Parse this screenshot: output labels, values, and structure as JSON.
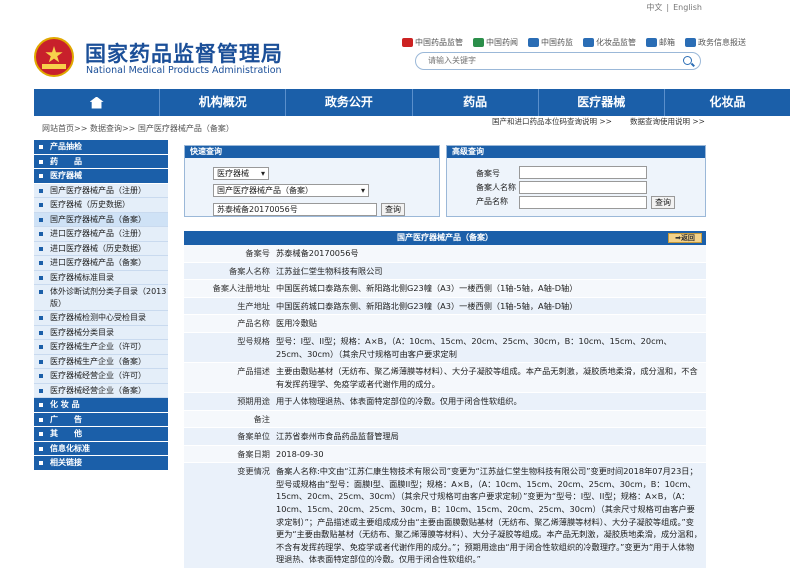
{
  "lang": {
    "cn": "中文",
    "sep": "|",
    "en": "English"
  },
  "header": {
    "title_cn": "国家药品监督管理局",
    "title_en": "National Medical Products Administration"
  },
  "toplinks": [
    "中国药品监管",
    "中国药闻",
    "中国药监",
    "化妆品监管",
    "邮箱",
    "政务信息报送"
  ],
  "search": {
    "placeholder": "请输入关键字"
  },
  "nav": [
    "机构概况",
    "政务公开",
    "药品",
    "医疗器械",
    "化妆品"
  ],
  "breadcrumb": "网站首页>> 数据查询>> 国产医疗器械产品（备案）",
  "right_links": [
    "国产和进口药品本位码查询说明 >>",
    "数据查询使用说明 >>"
  ],
  "sidebar": [
    {
      "label": "产品抽检",
      "type": "h"
    },
    {
      "label": "药　　品",
      "type": "h"
    },
    {
      "label": "医疗器械",
      "type": "h"
    },
    {
      "label": "国产医疗器械产品（注册）",
      "type": "s"
    },
    {
      "label": "医疗器械（历史数据）",
      "type": "s"
    },
    {
      "label": "国产医疗器械产品（备案）",
      "type": "s",
      "active": true
    },
    {
      "label": "进口医疗器械产品（注册）",
      "type": "s"
    },
    {
      "label": "进口医疗器械（历史数据）",
      "type": "s"
    },
    {
      "label": "进口医疗器械产品（备案）",
      "type": "s"
    },
    {
      "label": "医疗器械标准目录",
      "type": "s"
    },
    {
      "label": "体外诊断试剂分类子目录（2013版）",
      "type": "s",
      "tall": true
    },
    {
      "label": "医疗器械检测中心受检目录",
      "type": "s"
    },
    {
      "label": "医疗器械分类目录",
      "type": "s"
    },
    {
      "label": "医疗器械生产企业（许可）",
      "type": "s"
    },
    {
      "label": "医疗器械生产企业（备案）",
      "type": "s"
    },
    {
      "label": "医疗器械经营企业（许可）",
      "type": "s"
    },
    {
      "label": "医疗器械经营企业（备案）",
      "type": "s"
    },
    {
      "label": "化 妆 品",
      "type": "h"
    },
    {
      "label": "广　　告",
      "type": "h"
    },
    {
      "label": "其　　他",
      "type": "h"
    },
    {
      "label": "信息化标准",
      "type": "h"
    },
    {
      "label": "相关链接",
      "type": "h"
    }
  ],
  "quick": {
    "title": "快速查询",
    "sel1": "医疗器械",
    "sel2": "国产医疗器械产品（备案）",
    "input": "苏泰械备20170056号",
    "btn": "查询"
  },
  "adv": {
    "title": "高级查询",
    "f1": "备案号",
    "f2": "备案人名称",
    "f3": "产品名称",
    "btn": "查询"
  },
  "detail": {
    "title": "国产医疗器械产品（备案）",
    "back": "返回",
    "rows": [
      {
        "k": "备案号",
        "v": "苏泰械备20170056号"
      },
      {
        "k": "备案人名称",
        "v": "江苏益仁堂生物科技有限公司"
      },
      {
        "k": "备案人注册地址",
        "v": "中国医药城口泰路东侧、新阳路北侧G23幢（A3）一楼西侧（1轴-5轴，A轴-D轴）"
      },
      {
        "k": "生产地址",
        "v": "中国医药城口泰路东侧、新阳路北侧G23幢（A3）一楼西侧（1轴-5轴，A轴-D轴）"
      },
      {
        "k": "产品名称",
        "v": "医用冷敷贴"
      },
      {
        "k": "型号规格",
        "v": "型号：I型、II型；规格：A×B，（A：10cm、15cm、20cm、25cm、30cm，B：10cm、15cm、20cm、25cm、30cm）（其余尺寸规格可由客户要求定制"
      },
      {
        "k": "产品描述",
        "v": "主要由敷贴基材（无纺布、聚乙烯薄膜等材料）、大分子凝胶等组成。本产品无刺激，凝胶质地柔滑，成分温和，不含有发挥药理学、免疫学或者代谢作用的成分。"
      },
      {
        "k": "预期用途",
        "v": "用于人体物理退热、体表面特定部位的冷敷。仅用于闭合性软组织。"
      },
      {
        "k": "备注",
        "v": ""
      },
      {
        "k": "备案单位",
        "v": "江苏省泰州市食品药品监督管理局"
      },
      {
        "k": "备案日期",
        "v": "2018-09-30"
      },
      {
        "k": "变更情况",
        "v": "备案人名称:中文由“江苏仁康生物技术有限公司”变更为“江苏益仁堂生物科技有限公司”变更时间2018年07月23日；型号或规格由“型号：面膜I型、面膜II型；规格：A×B，（A：10cm、15cm、20cm、25cm、30cm，B：10cm、15cm、20cm、25cm、30cm）（其余尺寸规格可由客户要求定制）”变更为“型号：I型、II型；规格：A×B，（A：10cm、15cm、20cm、25cm、30cm，B：10cm、15cm、20cm、25cm、30cm）（其余尺寸规格可由客户要求定制）”；产品描述或主要组成成分由“主要由面膜敷贴基材（无纺布、聚乙烯薄膜等材料）、大分子凝胶等组成。”变更为“主要由敷贴基材（无纺布、聚乙烯薄膜等材料）、大分子凝胶等组成。本产品无刺激，凝胶质地柔滑，成分温和，不含有发挥药理学、免疫学或者代谢作用的成分。”；预期用途由“用于闭合性软组织的冷敷理疗。”变更为“用于人体物理退热、体表面特定部位的冷敷。仅用于闭合性软组织。”"
      }
    ]
  }
}
